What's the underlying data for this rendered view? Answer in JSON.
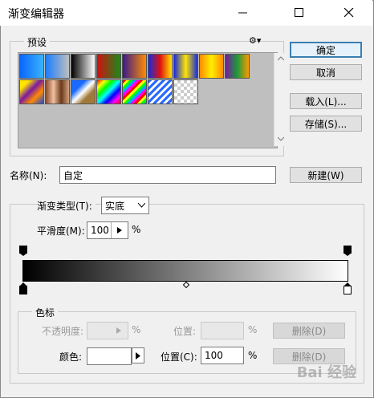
{
  "window": {
    "title": "渐变编辑器"
  },
  "presets": {
    "legend": "预设",
    "swatches": [
      {
        "name": "foreground-to-background-swatch",
        "bg": "linear-gradient(to right,#0a66ff,#38b4ff)"
      },
      {
        "name": "foreground-to-transparent-swatch",
        "bg": "linear-gradient(to right,#1b7dff,rgba(40,140,255,0))"
      },
      {
        "name": "black-white-swatch",
        "bg": "linear-gradient(to right,#000,#fff)"
      },
      {
        "name": "red-green-swatch",
        "bg": "linear-gradient(to right,#d21010,#1a8a1a)"
      },
      {
        "name": "violet-orange-swatch",
        "bg": "linear-gradient(to right,#3a1a8a,#ff8c00)"
      },
      {
        "name": "blue-red-yellow-swatch",
        "bg": "linear-gradient(to right,#1a2bd8,#e01010,#ffe400)"
      },
      {
        "name": "blue-yellow-blue-swatch",
        "bg": "linear-gradient(to right,#1a2bd8,#ffe400,#1a2bd8)"
      },
      {
        "name": "orange-yellow-orange-swatch",
        "bg": "linear-gradient(to right,#ff8a00,#ffef00,#ff8a00)"
      },
      {
        "name": "violet-green-orange-swatch",
        "bg": "linear-gradient(to right,#7a1aa0,#1a9a3a,#ff9a00)"
      },
      {
        "name": "yellow-violet-orange-blue-swatch",
        "bg": "linear-gradient(135deg,#ffe400 20%,#7a1aa0 45%,#ff8a00 70%,#1a4ad8)"
      },
      {
        "name": "copper-swatch",
        "bg": "linear-gradient(to right,#8a4a2a,#f0c0a0,#6a3a1a,#d0a080)"
      },
      {
        "name": "chrome-swatch",
        "bg": "linear-gradient(135deg,#1a6aff 30%,#fff 50%,#a07a3a 70%)"
      },
      {
        "name": "spectrum-swatch",
        "bg": "linear-gradient(135deg,#ff0000,#ffff00,#00ff00,#00ffff,#0000ff,#ff00ff,#ff0000)"
      },
      {
        "name": "transparent-rainbow-swatch",
        "bg": "repeating-linear-gradient(135deg,#ff0000 0 3px,#ffff00 3px 6px,#00ff00 6px 9px,#00aaff 9px 12px,#ff00ff 12px 15px)"
      },
      {
        "name": "transparent-stripes-swatch",
        "bg": "repeating-linear-gradient(135deg,#2a6aff 0 3px,#ffffff 3px 6px)"
      },
      {
        "name": "transparent-swatch",
        "bg": "checker"
      }
    ]
  },
  "buttons": {
    "ok": "确定",
    "cancel": "取消",
    "load": "载入(L)...",
    "save": "存储(S)...",
    "new": "新建(W)"
  },
  "name": {
    "label": "名称(N):",
    "value": "自定"
  },
  "gradient": {
    "type_label": "渐变类型(T):",
    "type_value": "实底",
    "smoothness_label": "平滑度(M):",
    "smoothness_value": "100",
    "smoothness_unit": "%"
  },
  "stops": {
    "legend": "色标",
    "opacity_label": "不透明度:",
    "opacity_unit": "%",
    "opacity_location_label": "位置:",
    "opacity_location_unit": "%",
    "delete_label": "删除(D)",
    "color_label": "颜色:",
    "color_value": "#ffffff",
    "color_location_label": "位置(C):",
    "color_location_value": "100",
    "color_location_unit": "%"
  },
  "watermark": "Bai 经验"
}
